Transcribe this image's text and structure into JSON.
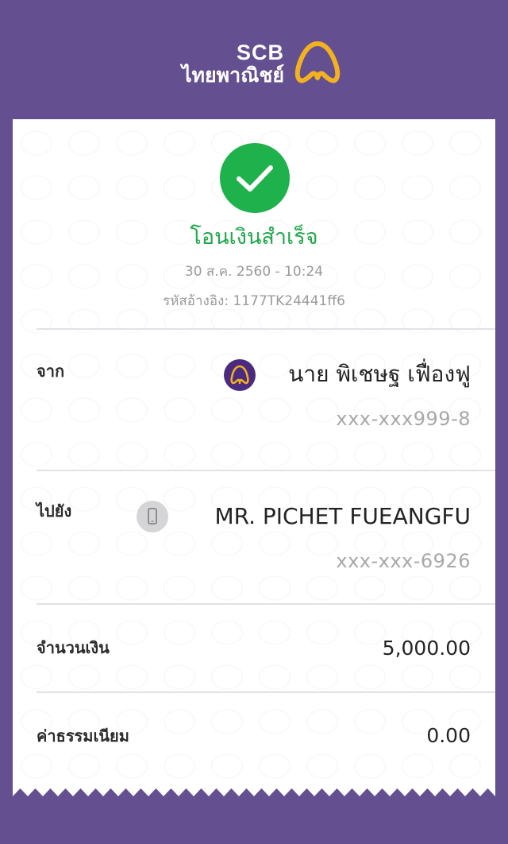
{
  "header": {
    "brand_short": "SCB",
    "brand_thai": "ไทยพาณิชย์",
    "colors": {
      "background": "#644f91",
      "logo_gold": "#f2b21f"
    }
  },
  "receipt": {
    "status_icon": "check-icon",
    "status_title": "โอนเงินสำเร็จ",
    "date_time": "30 ส.ค. 2560 - 10:24",
    "reference": "รหัสอ้างอิง: 1177TK24441ff6",
    "colors": {
      "success": "#1fb14b"
    },
    "from": {
      "label": "จาก",
      "icon": "scb-bank-icon",
      "name": "นาย พิเชษฐ เฟื่องฟู",
      "account": "xxx-xxx999-8"
    },
    "to": {
      "label": "ไปยัง",
      "icon": "mobile-phone-icon",
      "name": "MR. PICHET FUEANGFU",
      "account": "xxx-xxx-6926"
    },
    "amount": {
      "label": "จำนวนเงิน",
      "value": "5,000.00"
    },
    "fee": {
      "label": "ค่าธรรมเนียม",
      "value": "0.00"
    }
  }
}
